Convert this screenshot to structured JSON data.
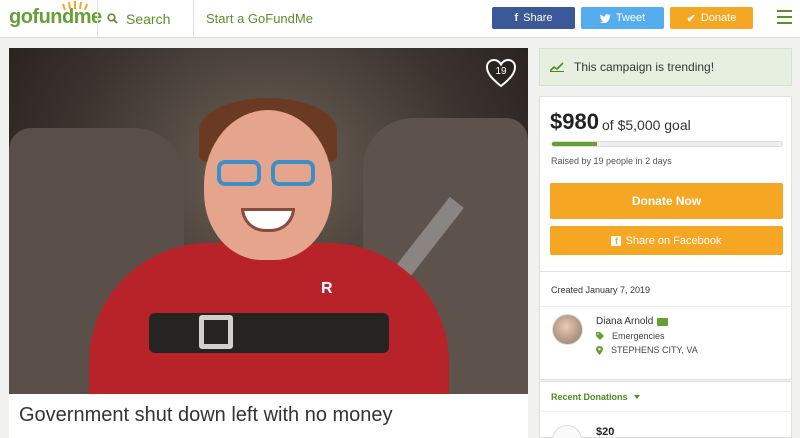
{
  "header": {
    "logo": "gofundme",
    "search_label": "Search",
    "start_label": "Start a GoFundMe",
    "share_label": "Share",
    "tweet_label": "Tweet",
    "donate_label": "Donate"
  },
  "campaign": {
    "title": "Government shut down left with no money",
    "favorites_count": "19"
  },
  "sidebar": {
    "trending_text": "This campaign is trending!",
    "amount_raised": "$980",
    "goal_text": "of $5,000 goal",
    "progress_fraction": 0.196,
    "raised_by_text": "Raised by 19 people in 2 days",
    "donate_now_label": "Donate Now",
    "share_facebook_label": "Share on Facebook",
    "created_text": "Created January 7, 2019",
    "organizer_name": "Diana Arnold",
    "category": "Emergencies",
    "location": "STEPHENS CITY, VA",
    "recent_donations_label": "Recent Donations",
    "first_donation_amount": "$20"
  },
  "colors": {
    "brand_green": "#64a034",
    "donate_orange": "#f5a623",
    "facebook_blue": "#3b5998",
    "twitter_blue": "#55acee"
  }
}
